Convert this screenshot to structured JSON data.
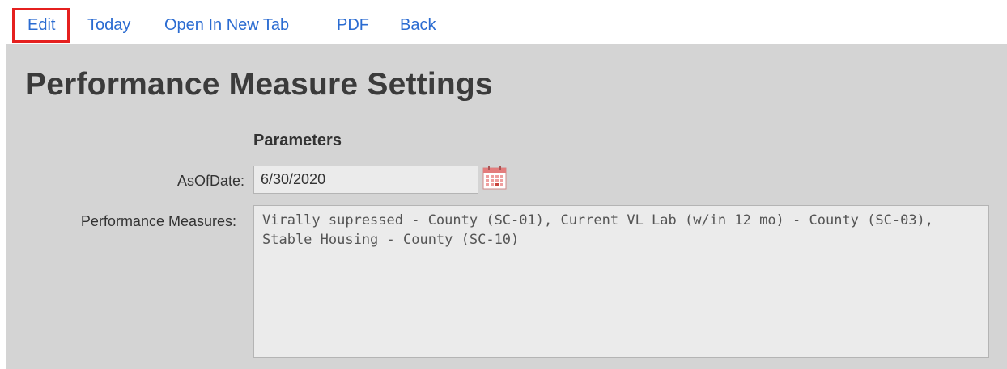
{
  "toolbar": {
    "links": {
      "edit": "Edit",
      "today": "Today",
      "open_new_tab": "Open In New Tab",
      "pdf": "PDF",
      "back": "Back"
    },
    "link_color": "#2a6bd1",
    "highlight_color": "#e5201f"
  },
  "page": {
    "title": "Performance Measure Settings"
  },
  "parameters": {
    "heading": "Parameters",
    "as_of_date": {
      "label": "AsOfDate:",
      "value": "6/30/2020"
    },
    "performance_measures": {
      "label": "Performance Measures:",
      "value": "Virally supressed - County (SC-01), Current VL Lab (w/in 12 mo) - County (SC-03), Stable Housing - County (SC-10)"
    }
  },
  "icons": {
    "calendar": "calendar-icon"
  },
  "colors": {
    "panel_background": "#d4d4d4",
    "field_background": "#ebebeb",
    "title_text": "#3b3b3b"
  }
}
